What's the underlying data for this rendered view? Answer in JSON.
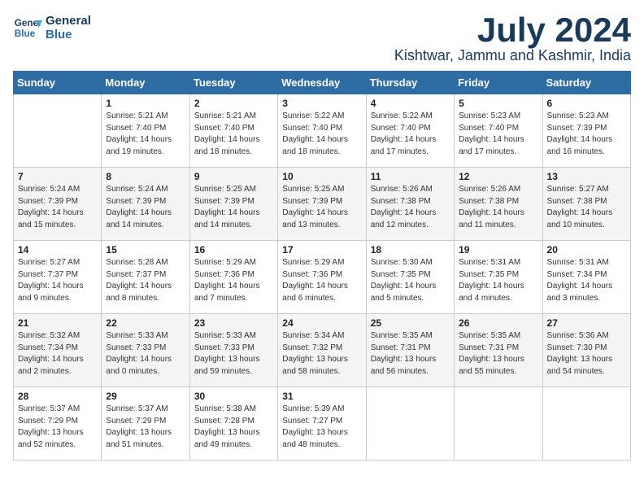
{
  "logo": {
    "line1": "General",
    "line2": "Blue"
  },
  "title": "July 2024",
  "location": "Kishtwar, Jammu and Kashmir, India",
  "days_header": [
    "Sunday",
    "Monday",
    "Tuesday",
    "Wednesday",
    "Thursday",
    "Friday",
    "Saturday"
  ],
  "weeks": [
    [
      {
        "day": "",
        "info": ""
      },
      {
        "day": "1",
        "info": "Sunrise: 5:21 AM\nSunset: 7:40 PM\nDaylight: 14 hours\nand 19 minutes."
      },
      {
        "day": "2",
        "info": "Sunrise: 5:21 AM\nSunset: 7:40 PM\nDaylight: 14 hours\nand 18 minutes."
      },
      {
        "day": "3",
        "info": "Sunrise: 5:22 AM\nSunset: 7:40 PM\nDaylight: 14 hours\nand 18 minutes."
      },
      {
        "day": "4",
        "info": "Sunrise: 5:22 AM\nSunset: 7:40 PM\nDaylight: 14 hours\nand 17 minutes."
      },
      {
        "day": "5",
        "info": "Sunrise: 5:23 AM\nSunset: 7:40 PM\nDaylight: 14 hours\nand 17 minutes."
      },
      {
        "day": "6",
        "info": "Sunrise: 5:23 AM\nSunset: 7:39 PM\nDaylight: 14 hours\nand 16 minutes."
      }
    ],
    [
      {
        "day": "7",
        "info": "Sunrise: 5:24 AM\nSunset: 7:39 PM\nDaylight: 14 hours\nand 15 minutes."
      },
      {
        "day": "8",
        "info": "Sunrise: 5:24 AM\nSunset: 7:39 PM\nDaylight: 14 hours\nand 14 minutes."
      },
      {
        "day": "9",
        "info": "Sunrise: 5:25 AM\nSunset: 7:39 PM\nDaylight: 14 hours\nand 14 minutes."
      },
      {
        "day": "10",
        "info": "Sunrise: 5:25 AM\nSunset: 7:39 PM\nDaylight: 14 hours\nand 13 minutes."
      },
      {
        "day": "11",
        "info": "Sunrise: 5:26 AM\nSunset: 7:38 PM\nDaylight: 14 hours\nand 12 minutes."
      },
      {
        "day": "12",
        "info": "Sunrise: 5:26 AM\nSunset: 7:38 PM\nDaylight: 14 hours\nand 11 minutes."
      },
      {
        "day": "13",
        "info": "Sunrise: 5:27 AM\nSunset: 7:38 PM\nDaylight: 14 hours\nand 10 minutes."
      }
    ],
    [
      {
        "day": "14",
        "info": "Sunrise: 5:27 AM\nSunset: 7:37 PM\nDaylight: 14 hours\nand 9 minutes."
      },
      {
        "day": "15",
        "info": "Sunrise: 5:28 AM\nSunset: 7:37 PM\nDaylight: 14 hours\nand 8 minutes."
      },
      {
        "day": "16",
        "info": "Sunrise: 5:29 AM\nSunset: 7:36 PM\nDaylight: 14 hours\nand 7 minutes."
      },
      {
        "day": "17",
        "info": "Sunrise: 5:29 AM\nSunset: 7:36 PM\nDaylight: 14 hours\nand 6 minutes."
      },
      {
        "day": "18",
        "info": "Sunrise: 5:30 AM\nSunset: 7:35 PM\nDaylight: 14 hours\nand 5 minutes."
      },
      {
        "day": "19",
        "info": "Sunrise: 5:31 AM\nSunset: 7:35 PM\nDaylight: 14 hours\nand 4 minutes."
      },
      {
        "day": "20",
        "info": "Sunrise: 5:31 AM\nSunset: 7:34 PM\nDaylight: 14 hours\nand 3 minutes."
      }
    ],
    [
      {
        "day": "21",
        "info": "Sunrise: 5:32 AM\nSunset: 7:34 PM\nDaylight: 14 hours\nand 2 minutes."
      },
      {
        "day": "22",
        "info": "Sunrise: 5:33 AM\nSunset: 7:33 PM\nDaylight: 14 hours\nand 0 minutes."
      },
      {
        "day": "23",
        "info": "Sunrise: 5:33 AM\nSunset: 7:33 PM\nDaylight: 13 hours\nand 59 minutes."
      },
      {
        "day": "24",
        "info": "Sunrise: 5:34 AM\nSunset: 7:32 PM\nDaylight: 13 hours\nand 58 minutes."
      },
      {
        "day": "25",
        "info": "Sunrise: 5:35 AM\nSunset: 7:31 PM\nDaylight: 13 hours\nand 56 minutes."
      },
      {
        "day": "26",
        "info": "Sunrise: 5:35 AM\nSunset: 7:31 PM\nDaylight: 13 hours\nand 55 minutes."
      },
      {
        "day": "27",
        "info": "Sunrise: 5:36 AM\nSunset: 7:30 PM\nDaylight: 13 hours\nand 54 minutes."
      }
    ],
    [
      {
        "day": "28",
        "info": "Sunrise: 5:37 AM\nSunset: 7:29 PM\nDaylight: 13 hours\nand 52 minutes."
      },
      {
        "day": "29",
        "info": "Sunrise: 5:37 AM\nSunset: 7:29 PM\nDaylight: 13 hours\nand 51 minutes."
      },
      {
        "day": "30",
        "info": "Sunrise: 5:38 AM\nSunset: 7:28 PM\nDaylight: 13 hours\nand 49 minutes."
      },
      {
        "day": "31",
        "info": "Sunrise: 5:39 AM\nSunset: 7:27 PM\nDaylight: 13 hours\nand 48 minutes."
      },
      {
        "day": "",
        "info": ""
      },
      {
        "day": "",
        "info": ""
      },
      {
        "day": "",
        "info": ""
      }
    ]
  ]
}
